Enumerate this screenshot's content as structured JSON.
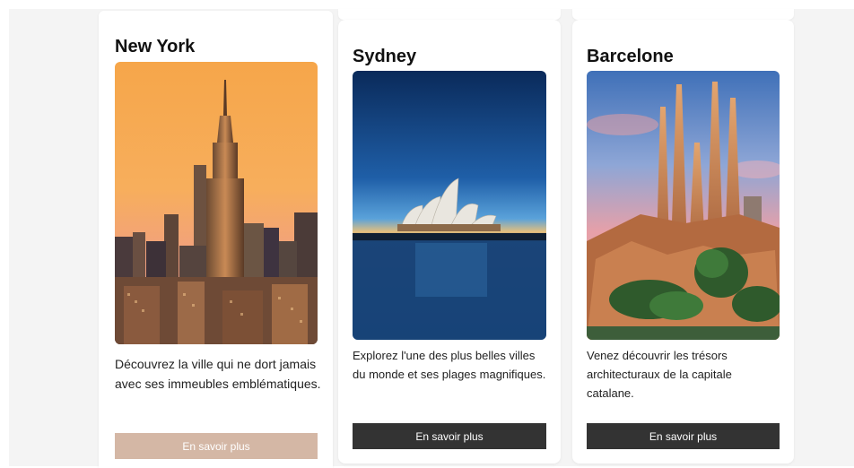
{
  "cards": [
    {
      "title": "New York",
      "description": "Découvrez la ville qui ne dort jamais avec ses immeubles emblématiques.",
      "button_label": "En savoir plus",
      "button_color": "#d4b7a5",
      "image": "new-york-skyline-photo"
    },
    {
      "title": "Sydney",
      "description": "Explorez l'une des plus belles villes du monde et ses plages magnifiques.",
      "button_label": "En savoir plus",
      "button_color": "#333333",
      "image": "sydney-opera-house-photo"
    },
    {
      "title": "Barcelone",
      "description": "Venez découvrir les trésors architecturaux de la capitale catalane.",
      "button_label": "En savoir plus",
      "button_color": "#333333",
      "image": "sagrada-familia-photo"
    }
  ]
}
